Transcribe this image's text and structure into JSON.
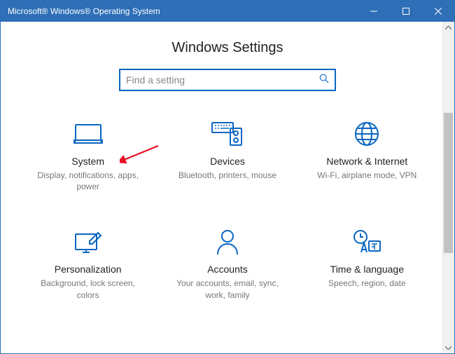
{
  "window": {
    "title": "Microsoft® Windows® Operating System"
  },
  "page": {
    "title": "Windows Settings"
  },
  "search": {
    "placeholder": "Find a setting"
  },
  "tiles": {
    "system": {
      "name": "System",
      "desc": "Display, notifications, apps, power"
    },
    "devices": {
      "name": "Devices",
      "desc": "Bluetooth, printers, mouse"
    },
    "network": {
      "name": "Network & Internet",
      "desc": "Wi-Fi, airplane mode, VPN"
    },
    "personalization": {
      "name": "Personalization",
      "desc": "Background, lock screen, colors"
    },
    "accounts": {
      "name": "Accounts",
      "desc": "Your accounts, email, sync, work, family"
    },
    "time": {
      "name": "Time & language",
      "desc": "Speech, region, date"
    }
  },
  "colors": {
    "accent": "#0a66c2",
    "titlebar": "#2e6fb7",
    "arrow": "#e81123"
  }
}
